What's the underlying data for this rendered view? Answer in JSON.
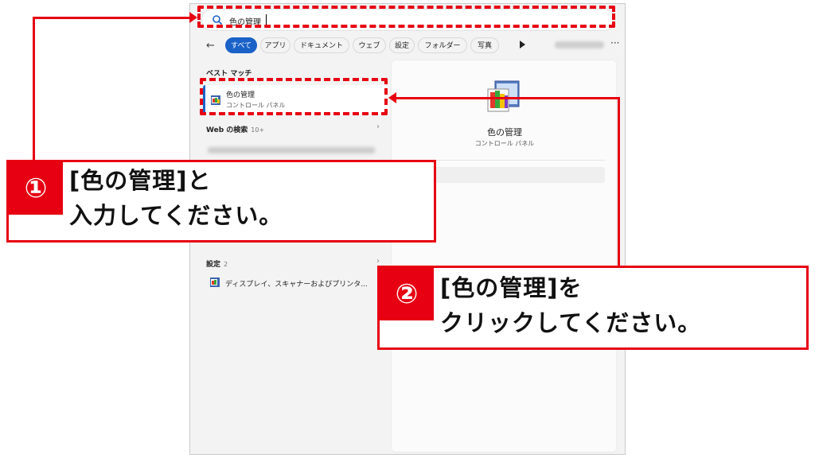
{
  "search": {
    "value": "色の管理"
  },
  "tabs": [
    {
      "label": "すべて",
      "active": true
    },
    {
      "label": "アプリ"
    },
    {
      "label": "ドキュメント"
    },
    {
      "label": "ウェブ"
    },
    {
      "label": "設定"
    },
    {
      "label": "フォルダー"
    },
    {
      "label": "写真"
    }
  ],
  "best_match": {
    "header": "ベスト マッチ",
    "item": {
      "name": "色の管理",
      "subtitle": "コントロール パネル"
    }
  },
  "web_section": {
    "header": "Web の検索",
    "count": "10+"
  },
  "settings_section": {
    "header": "設定",
    "count": "2",
    "item": "ディスプレイ、スキャナーおよびプリンタ..."
  },
  "preview": {
    "title": "色の管理",
    "subtitle": "コントロール パネル"
  },
  "callouts": [
    {
      "number": "①",
      "line1": "[色の管理]と",
      "line2": "入力してください。"
    },
    {
      "number": "②",
      "line1": "[色の管理]を",
      "line2": "クリックしてください。"
    }
  ],
  "colors": {
    "accent": "#1a62c8",
    "annotation": "#e60012"
  }
}
